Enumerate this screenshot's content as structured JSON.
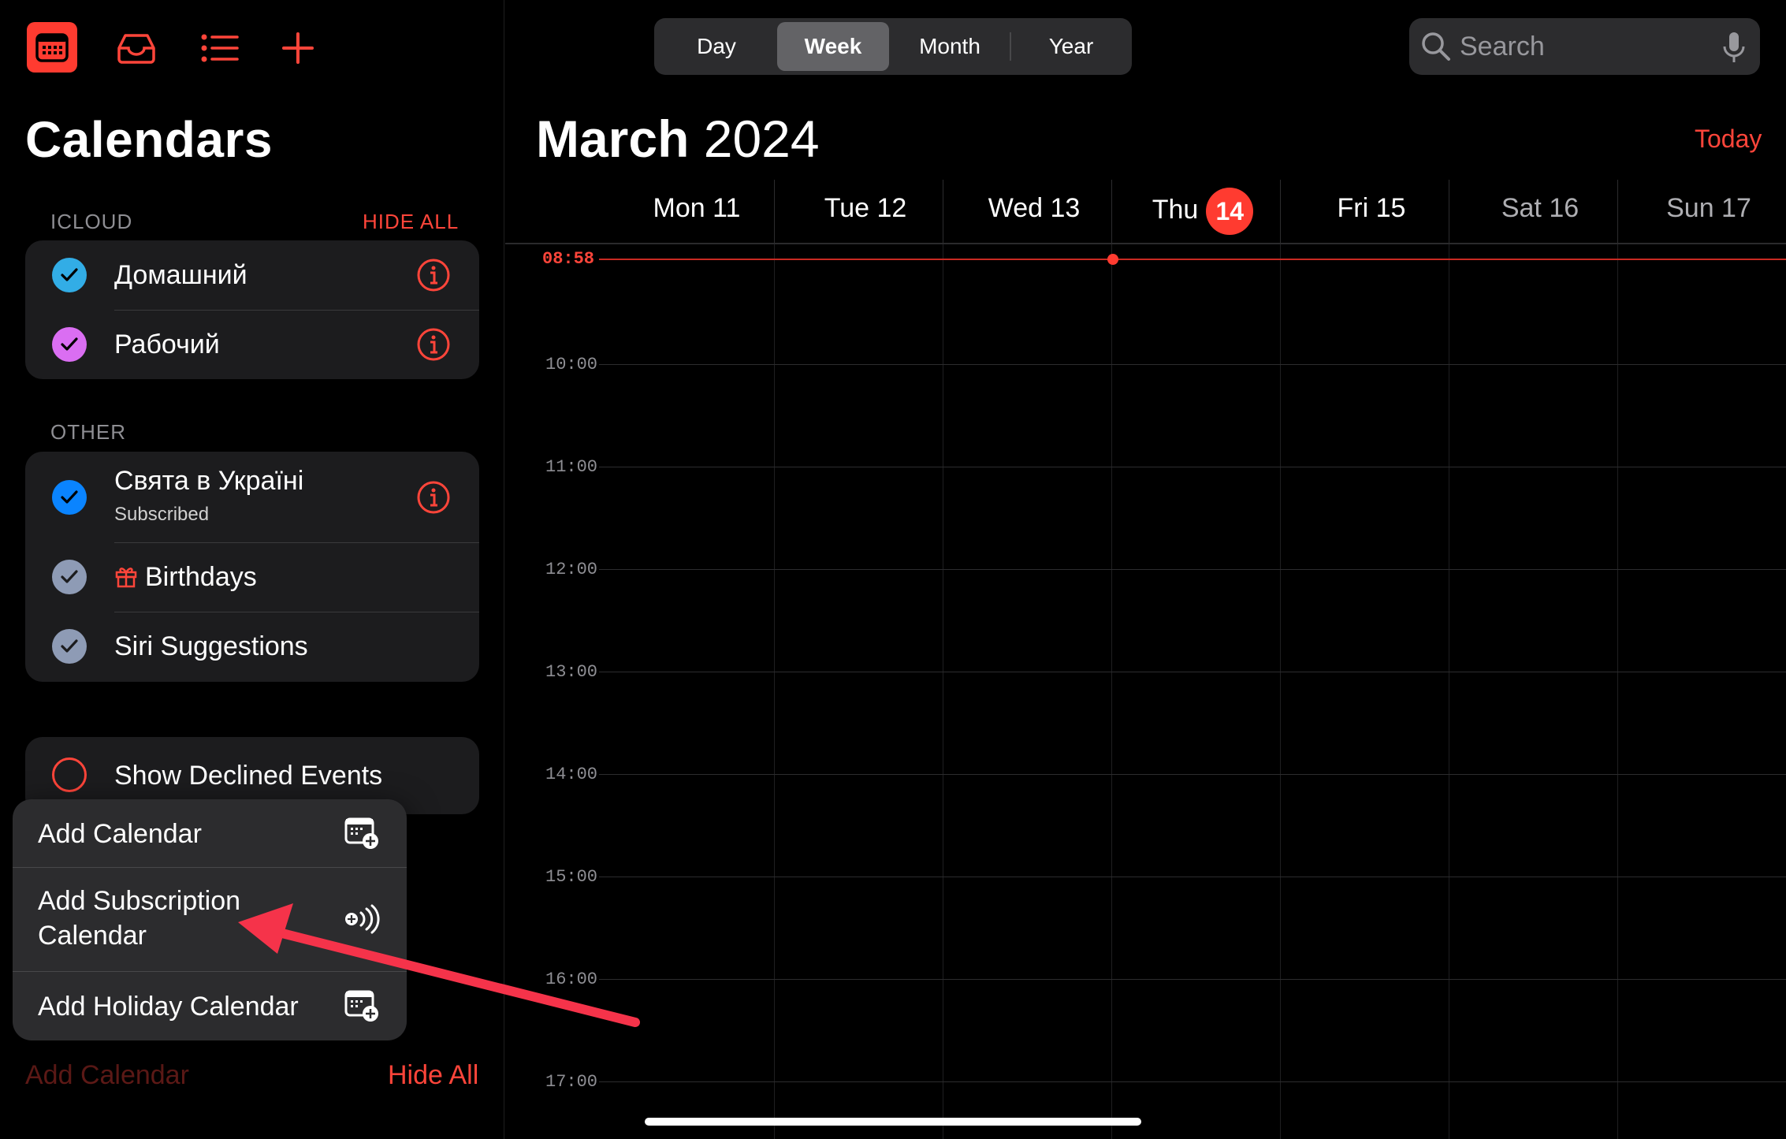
{
  "toolbar": {
    "icons": [
      "calendar-icon",
      "inbox-icon",
      "list-icon",
      "plus-icon"
    ]
  },
  "sidebar": {
    "title": "Calendars",
    "icloud": {
      "label": "ICLOUD",
      "hide_all": "HIDE ALL",
      "items": [
        {
          "name": "Домашний",
          "color": "#32ade6",
          "checked": true
        },
        {
          "name": "Рабочий",
          "color": "#da6ef2",
          "checked": true
        }
      ]
    },
    "other": {
      "label": "OTHER",
      "items": [
        {
          "name": "Свята в Україні",
          "sublabel": "Subscribed",
          "color": "#0a84ff",
          "checked": true
        },
        {
          "name": "Birthdays",
          "color": "#8e8e93",
          "checked": true
        },
        {
          "name": "Siri Suggestions",
          "color": "#8e8e93",
          "checked": true
        }
      ]
    },
    "show_declined": "Show Declined Events",
    "bottom_add": "Add Calendar",
    "bottom_hide": "Hide All"
  },
  "popup": {
    "items": [
      {
        "label": "Add Calendar",
        "icon": "calendar-add-icon"
      },
      {
        "label_line1": "Add Subscription",
        "label_line2": "Calendar",
        "icon": "subscription-add-icon"
      },
      {
        "label": "Add Holiday Calendar",
        "icon": "calendar-add-icon"
      }
    ]
  },
  "view_switcher": {
    "options": [
      "Day",
      "Week",
      "Month",
      "Year"
    ],
    "selected": "Week"
  },
  "search": {
    "placeholder": "Search"
  },
  "header": {
    "month": "March",
    "year": "2024",
    "today_button": "Today"
  },
  "days": [
    {
      "label": "Mon 11"
    },
    {
      "label": "Tue 12"
    },
    {
      "label": "Wed 13"
    },
    {
      "label": "Thu",
      "badge": "14",
      "is_today": true
    },
    {
      "label": "Fri 15"
    },
    {
      "label": "Sat 16",
      "weekend": true
    },
    {
      "label": "Sun 17",
      "weekend": true
    }
  ],
  "current_time": "08:58",
  "hours": [
    "10:00",
    "11:00",
    "12:00",
    "13:00",
    "14:00",
    "15:00",
    "16:00",
    "17:00"
  ],
  "colors": {
    "accent": "#ff3b30",
    "background": "#000000",
    "panel": "#1c1c1e"
  }
}
